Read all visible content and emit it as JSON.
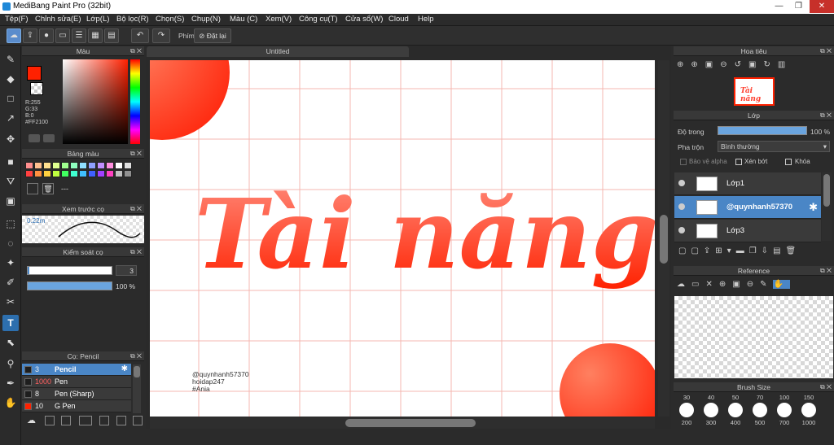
{
  "window": {
    "title": "MediBang Paint Pro (32bit)"
  },
  "menu": [
    "Tệp(F)",
    "Chỉnh sửa(E)",
    "Lớp(L)",
    "Bộ lọc(R)",
    "Chọn(S)",
    "Chụp(N)",
    "Màu (C)",
    "Xem(V)",
    "Công cụ(T)",
    "Cửa sổ(W)",
    "Cloud",
    "Help"
  ],
  "toolbar": {
    "shortcut_label": "Phím",
    "reset_label": "Đặt lại"
  },
  "color_panel": {
    "title": "Màu",
    "r": "R:255",
    "g": "G:33",
    "b": "B:0",
    "hex": "#FF2100",
    "fg_color": "#ff2100"
  },
  "palette_panel": {
    "title": "Bảng màu",
    "label": "---",
    "swatches": [
      "#ff8f8f",
      "#ffbf8f",
      "#ffe08f",
      "#dfff8f",
      "#a0ff8f",
      "#8fffc0",
      "#8fdfff",
      "#8fa0ff",
      "#c08fff",
      "#ff8fdf",
      "#ffffff",
      "#e0e0e0",
      "#ff4040",
      "#ff9040",
      "#ffd040",
      "#c0ff40",
      "#40ff60",
      "#40ffd0",
      "#40c0ff",
      "#4060ff",
      "#a040ff",
      "#ff40c0",
      "#c0c0c0",
      "#909090"
    ]
  },
  "brush_preview": {
    "title": "Xem trước cọ",
    "size_text": "0.22m"
  },
  "brush_control": {
    "title": "Kiểm soát cọ",
    "size_value": "3",
    "opacity_value": "100 %"
  },
  "brush_list": {
    "title": "Cọ: Pencil",
    "items": [
      {
        "size": "3",
        "name": "Pencil",
        "selected": true,
        "color": "#1e1e1e"
      },
      {
        "size": "1000",
        "name": "Pen",
        "selected": false,
        "color": "#1e1e1e"
      },
      {
        "size": "8",
        "name": "Pen (Sharp)",
        "selected": false,
        "color": "#1e1e1e"
      },
      {
        "size": "10",
        "name": "G Pen",
        "selected": false,
        "color": "#ff2100"
      }
    ]
  },
  "canvas": {
    "tab_title": "Untitled",
    "artwork_text": "Tài năng",
    "watermark": [
      "@quynhanh57370",
      "hoidap247",
      "#Ania"
    ]
  },
  "navigator": {
    "title": "Hoa tiêu"
  },
  "layers_panel": {
    "title": "Lớp",
    "opacity_label": "Độ trong",
    "opacity_value": "100 %",
    "blend_label": "Pha trộn",
    "blend_value": "Bình thường",
    "protect_alpha": "Bảo vệ alpha",
    "clipping": "Xén bớt",
    "lock": "Khóa",
    "layers": [
      {
        "name": "Lớp1",
        "selected": false
      },
      {
        "name": "@quynhanh57370",
        "selected": true
      },
      {
        "name": "Lớp3",
        "selected": false
      }
    ]
  },
  "reference_panel": {
    "title": "Reference"
  },
  "brush_size_panel": {
    "title": "Brush Size",
    "row1": [
      "30",
      "40",
      "50",
      "70",
      "100",
      "150"
    ],
    "row2": [
      "200",
      "300",
      "400",
      "500",
      "700",
      "1000"
    ]
  }
}
